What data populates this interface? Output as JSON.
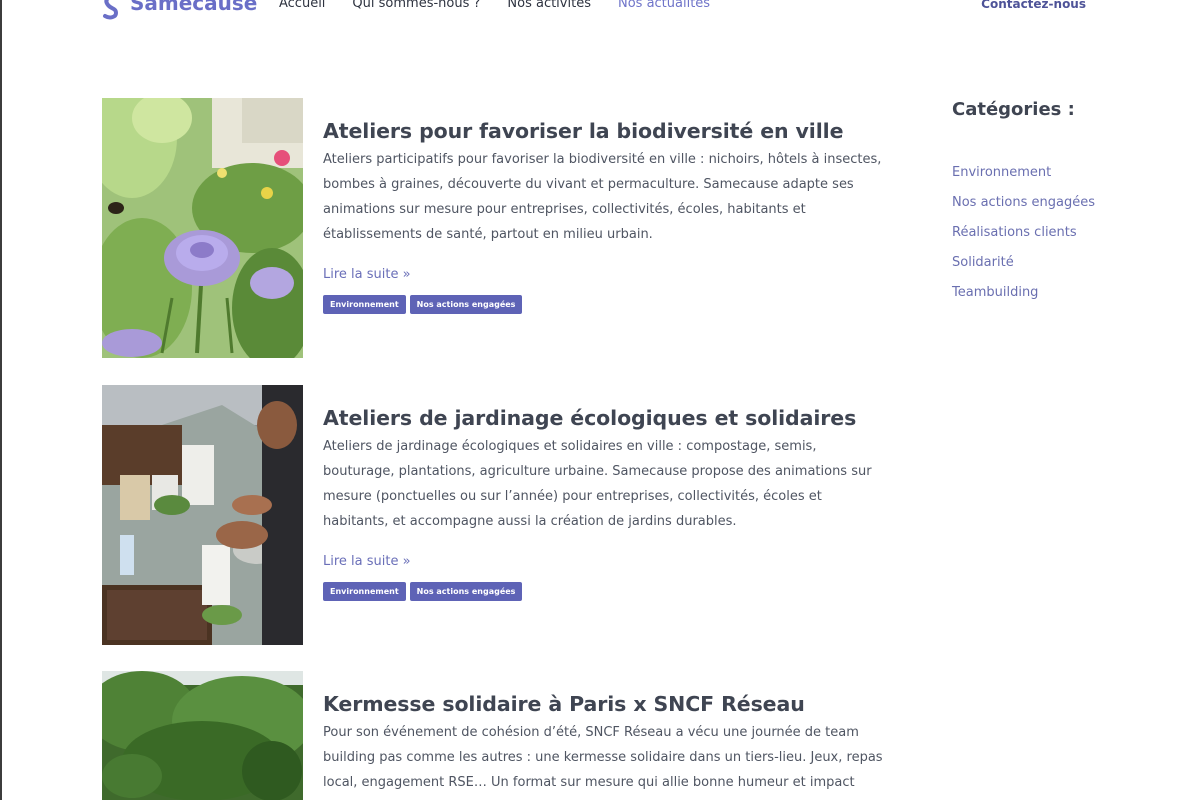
{
  "brand": {
    "name": "Samecause",
    "color": "#6a6fc7"
  },
  "nav": {
    "items": [
      {
        "label": "Accueil",
        "active": false
      },
      {
        "label": "Qui sommes-nous ?",
        "active": false
      },
      {
        "label": "Nos activités",
        "active": false
      },
      {
        "label": "Nos actualités",
        "active": true
      }
    ],
    "contact_label": "Contactez-nous"
  },
  "articles": [
    {
      "title": "Ateliers pour favoriser la biodiversité en ville",
      "excerpt": "Ateliers participatifs pour favoriser la biodiversité en ville : nichoirs, hôtels à insectes, bombes à graines, découverte du vivant et permaculture. Samecause adapte ses animations sur mesure pour entreprises, collectivités, écoles, habitants et établissements de santé, partout en milieu urbain.",
      "read_more": "Lire la suite »",
      "tags": [
        "Environnement",
        "Nos actions engagées"
      ]
    },
    {
      "title": "Ateliers de jardinage écologiques et solidaires",
      "excerpt": "Ateliers de jardinage écologiques et solidaires en ville : compostage, semis, bouturage, plantations, agriculture urbaine. Samecause propose des animations sur mesure (ponctuelles ou sur l’année) pour entreprises, collectivités, écoles et habitants, et accompagne aussi la création de jardins durables.",
      "read_more": "Lire la suite »",
      "tags": [
        "Environnement",
        "Nos actions engagées"
      ]
    },
    {
      "title": "Kermesse solidaire à Paris x SNCF Réseau",
      "excerpt": "Pour son événement de cohésion d’été, SNCF Réseau a vécu une journée de team building pas comme les autres : une kermesse solidaire dans un tiers-lieu. Jeux, repas local, engagement RSE… Un format sur mesure qui allie bonne humeur et impact positif."
    }
  ],
  "sidebar": {
    "title": "Catégories :",
    "categories": [
      "Environnement",
      "Nos actions engagées",
      "Réalisations clients",
      "Solidarité",
      "Teambuilding"
    ]
  },
  "colors": {
    "tag_bg": "#5e63b6",
    "link": "#6a6fb8",
    "heading": "#3f4552"
  }
}
